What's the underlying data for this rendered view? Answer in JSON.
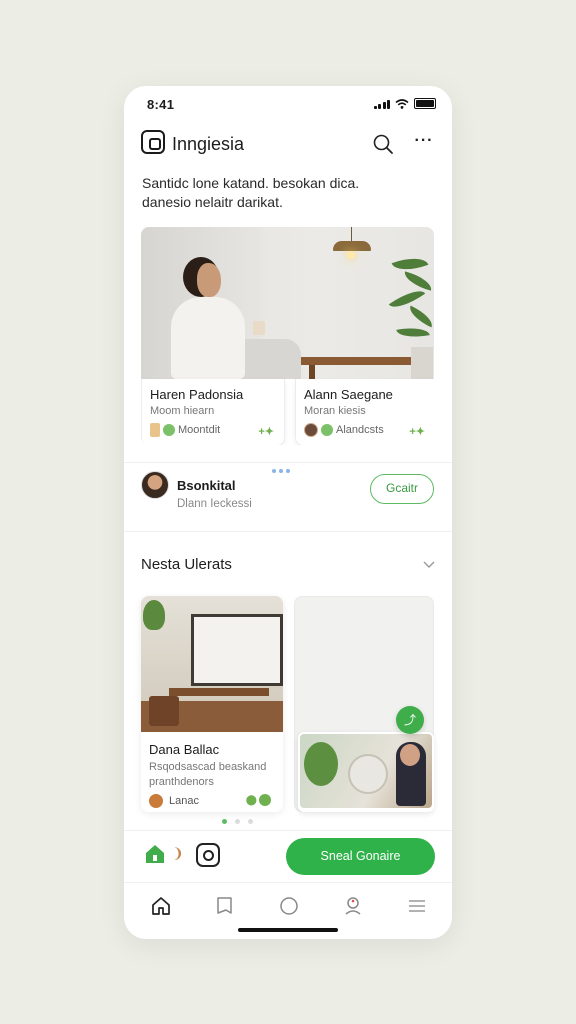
{
  "status_bar": {
    "time": "8:41"
  },
  "header": {
    "title": "Inngiesia"
  },
  "intro_text": "Santidc lone katand. besokan dica. danesio nelaitr darikat.",
  "featured": {
    "cards": [
      {
        "title": "Haren Padonsia",
        "subtitle": "Moom hiearn",
        "meta": "Moontdit"
      },
      {
        "title": "Alann Saegane",
        "subtitle": "Moran kiesis",
        "meta": "Alandcsts"
      }
    ]
  },
  "follow": {
    "name": "Bsonkital",
    "subtitle": "Dlann Ieckessi",
    "button_label": "Gcaitr"
  },
  "section": {
    "title": "Nesta Ulerats"
  },
  "grid_card": {
    "title": "Dana Ballac",
    "description": "Rsqodsascad beaskand pranthdenors",
    "meta": "Lanac"
  },
  "action_bar": {
    "cta_label": "Sneal Gonaire"
  },
  "colors": {
    "accent": "#2fb24a",
    "background": "#eceee6"
  }
}
